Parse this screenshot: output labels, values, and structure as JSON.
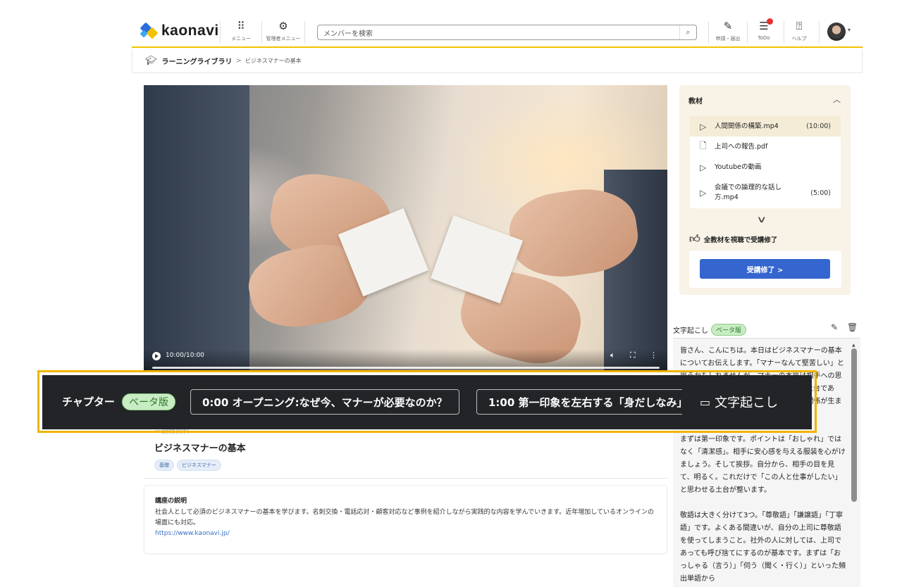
{
  "header": {
    "logo_text": "kaonavi",
    "logo_colors": [
      "#2a6fdb",
      "#f2c200",
      "#3aaaf0"
    ],
    "menu_label": "メニュー",
    "menu_icon": "grid-icon",
    "admin_menu_label": "管理者メニュー",
    "admin_icon": "gear-icon",
    "search_placeholder": "メンバーを検索",
    "apply_label": "申請・届出",
    "apply_icon": "document-edit-icon",
    "todo_label": "ToDo",
    "todo_icon": "checklist-icon",
    "help_label": "ヘルプ",
    "help_icon": "question-icon",
    "accent_color": "#f2c200"
  },
  "breadcrumb": {
    "root": "ラーニングライブラリ",
    "separator": ">",
    "current": "ビジネスマナーの基本"
  },
  "video": {
    "time": "10:00/10:00",
    "progress": 1.0
  },
  "course": {
    "subtitle": "ー研修資料",
    "title": "ビジネスマナーの基本",
    "tags": [
      "基礎",
      "ビジネスマナー"
    ],
    "desc_heading": "講座の説明",
    "description": "社会人として必須のビジネスマナーの基本を学びます。名刺交換・電話応対・顧客対応など事例を紹介しながら実践的な内容を学んでいきます。近年増加しているオンラインの場面にも対応。",
    "url": "https://www.kaonavi.jp/"
  },
  "materials": {
    "heading": "教材",
    "items": [
      {
        "label": "人間関係の構築.mp4",
        "duration": "(10:00)",
        "icon": "play-icon",
        "selected": true
      },
      {
        "label": "上司への報告.pdf",
        "duration": "",
        "icon": "file-icon",
        "selected": false
      },
      {
        "label": "Youtubeの動画",
        "duration": "",
        "icon": "play-icon",
        "selected": false
      },
      {
        "label": "会議での論理的な話し方.mp4",
        "duration": "(5:00)",
        "icon": "play-icon",
        "selected": false
      }
    ],
    "complete_note": "全教材を視聴で受講修了",
    "complete_button": "受講修了 >"
  },
  "transcript": {
    "title": "文字起こし",
    "badge": "ベータ版",
    "paragraphs": [
      "皆さん、こんにちは。本日はビジネスマナーの基本についてお伝えします。「マナーなんて堅苦しい」と思うかもしれませんが、マナーの本質は相手への思いやりです。仕事を円滑に進めるための土台であり、きちんと身につければ相手との信頼関係が生まれ、仕事にも集中できるようになります。",
      "まずは第一印象です。ポイントは「おしゃれ」ではなく「清潔感」。相手に安心感を与える服装を心がけましょう。そして挨拶。自分から、相手の目を見て、明るく。これだけで「この人と仕事がしたい」と思わせる土台が整います。",
      "敬語は大きく分けて3つ。「尊敬語」「謙譲語」「丁寧語」です。よくある間違いが、自分の上司に尊敬語を使ってしまうこと。社外の人に対しては、上司であっても呼び捨てにするのが基本です。まずは「おっしゃる（言う）」「伺う（聞く・行く）」といった頻出単語から"
    ]
  },
  "chapters": {
    "label": "チャプター",
    "badge": "ベータ版",
    "items": [
      "0:00 オープニング:なぜ今、マナーが必要なのか？",
      "1:00 第一印象を左右する「身だしなみ」"
    ],
    "transcript_toggle": "文字起こし",
    "frame_color": "#f0b400"
  }
}
